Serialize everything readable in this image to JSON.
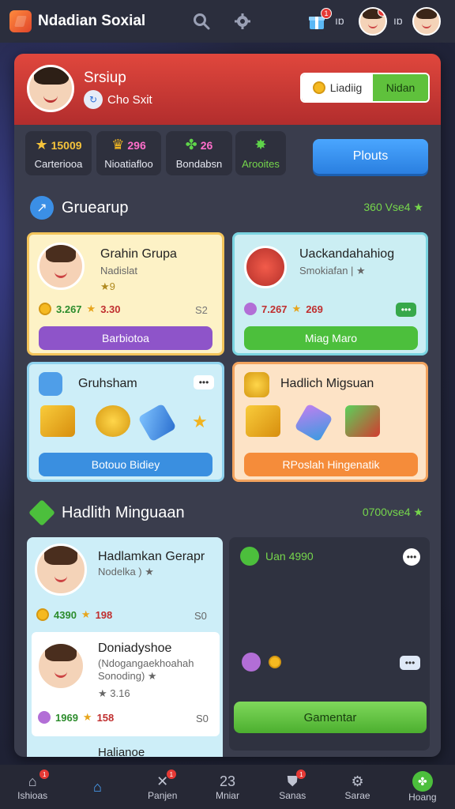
{
  "app": {
    "title": "Ndadian Soxial",
    "notif_count": "1"
  },
  "topbar": {
    "text1": "ıɒ",
    "text2": "ıɒ"
  },
  "profile": {
    "name": "Srsiup",
    "sub": "Cho Sxit",
    "toggle_left": "Liadiig",
    "toggle_right": "Nidan"
  },
  "stats": [
    {
      "value": "15009",
      "label": "Carteriooa",
      "color": "#f5c33b"
    },
    {
      "value": "296",
      "label": "Nioatiafloo",
      "color": "#ff6ecb"
    },
    {
      "value": "26",
      "label": "Bondabsn",
      "color": "#ff6ecb"
    },
    {
      "value": "",
      "label": "Arooites",
      "color": "#76d64c"
    }
  ],
  "play_button": "Plouts",
  "section1": {
    "title": "Gruearup",
    "right": "360 Vse4 ★"
  },
  "cards": {
    "c1": {
      "title": "Grahin Grupa",
      "sub": "Nadislat",
      "sub2": "★9",
      "v1": "3.267",
      "v2": "3.30",
      "v3": "S2",
      "button": "Barbiotoa"
    },
    "c2": {
      "title": "Uackandahahiog",
      "sub": "Smokiafan | ★",
      "v1": "7.267",
      "v2": "269",
      "button": "Miag Maro"
    },
    "c3": {
      "title": "Gruhsham",
      "button": "Botouo Bidiey"
    },
    "c4": {
      "title": "Hadlich Migsuan",
      "button": "RPoslah Hingenatik"
    }
  },
  "section2": {
    "title": "Hadlith Minguaan",
    "right": "0700vse4 ★"
  },
  "list": [
    {
      "title": "Hadlamkan Gerapr",
      "sub": "Nodelka ) ★",
      "v1": "4390",
      "v2": "198",
      "v3": "S0"
    },
    {
      "title": "Doniadyshoe",
      "sub": "(Ndogangaekhoahah",
      "sub2": "Sonoding) ★",
      "sub3": "★ 3.16",
      "v1": "1969",
      "v2": "158",
      "v3": "S0"
    },
    {
      "title": "Halianoe"
    }
  ],
  "right_panel": {
    "label": "Uan 4990",
    "button": "Gamentar"
  },
  "nav": [
    {
      "label": "Ishioas",
      "icon": "home-icon",
      "badge": "1"
    },
    {
      "label": "",
      "icon": "home-active-icon"
    },
    {
      "label": "Panjen",
      "icon": "gift-icon",
      "badge": "1"
    },
    {
      "label": "Mniar",
      "icon": "grid-icon",
      "top": "23"
    },
    {
      "label": "Sanas",
      "icon": "shield-icon",
      "badge": "1"
    },
    {
      "label": "Sarae",
      "icon": "gear-icon"
    },
    {
      "label": "Hoang",
      "icon": "clover-icon"
    }
  ]
}
